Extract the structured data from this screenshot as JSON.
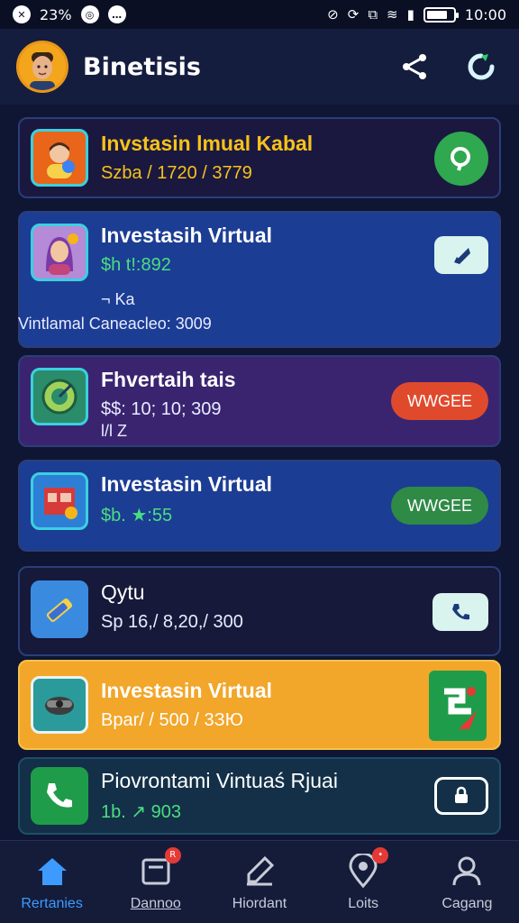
{
  "status_bar": {
    "battery_text": "23%",
    "time": "10:00",
    "battery_level": 0.8
  },
  "header": {
    "title": "Binetisis"
  },
  "cards": [
    {
      "title": "Invstasin lmual Kabal",
      "subtitle": "Szba / 1720 / 3779",
      "title_color": "#f6c21a",
      "subtitle_color": "#f6c21a",
      "bg": "#1b1840",
      "action": {
        "type": "circle",
        "icon": "search-icon",
        "color": "#2fa84f"
      }
    },
    {
      "title": "Investasih Virtual",
      "subtitle": "$h t!:892",
      "extra1": "¬ Ka",
      "extra2": "Vintlamal Caneacleo: 3009",
      "title_color": "#ffffff",
      "subtitle_color": "#4ade80",
      "bg": "#1c3d94",
      "action": {
        "type": "square",
        "icon": "edit-icon"
      }
    },
    {
      "title": "Fhvertaih tais",
      "subtitle": "$$: 10; 10; 309",
      "extra1": "l/l Z",
      "title_color": "#ffffff",
      "subtitle_color": "#e8ecff",
      "bg": "#3a2470",
      "action": {
        "type": "pill",
        "label": "WWGEE",
        "color": "#e04a2c"
      }
    },
    {
      "title": "Investasin Virtual",
      "subtitle": "$b. ★:55",
      "title_color": "#ffffff",
      "subtitle_color": "#4ade80",
      "bg": "#1c3d94",
      "action": {
        "type": "pill",
        "label": "WWGEE",
        "color": "#2f8a46"
      }
    },
    {
      "title": "Qytu",
      "subtitle": "Sp 16,/ 8,20,/ 300",
      "title_color": "#ffffff",
      "subtitle_color": "#e8ecff",
      "bg": "#17193a",
      "action": {
        "type": "square",
        "icon": "phone-icon"
      }
    },
    {
      "title": "Investasin Virtual",
      "subtitle": "Bpar/ / 500 / 3ЗЮ",
      "title_color": "#ffffff",
      "subtitle_color": "#ffffff",
      "bg": "#f2a62a",
      "action": {
        "type": "app",
        "icon": "send-icon"
      }
    },
    {
      "title": "Piovrontami Vintuaś Rjuai",
      "subtitle": "1b. ↗ 903",
      "title_color": "#ffffff",
      "subtitle_color": "#4ade80",
      "bg": "#133048",
      "action": {
        "type": "outline",
        "icon": "lock-icon"
      }
    }
  ],
  "bottom_nav": [
    {
      "label": "Rertanies",
      "icon": "home-icon",
      "active": true
    },
    {
      "label": "Dannoo",
      "icon": "archive-icon",
      "active": false,
      "badge": "R"
    },
    {
      "label": "Hiordant",
      "icon": "pencil-icon",
      "active": false
    },
    {
      "label": "Loits",
      "icon": "location-icon",
      "active": false,
      "badge": "•"
    },
    {
      "label": "Cagang",
      "icon": "user-icon",
      "active": false
    }
  ]
}
